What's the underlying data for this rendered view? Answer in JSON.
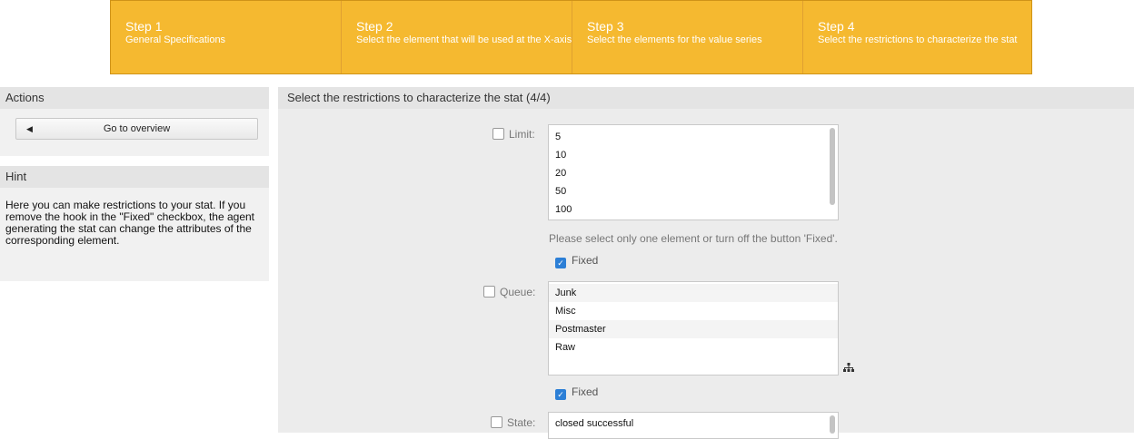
{
  "wizard": {
    "steps": [
      {
        "num": "Step 1",
        "desc": "General Specifications"
      },
      {
        "num": "Step 2",
        "desc": "Select the element that will be used at the X-axis"
      },
      {
        "num": "Step 3",
        "desc": "Select the elements for the value series"
      },
      {
        "num": "Step 4",
        "desc": "Select the restrictions to characterize the stat"
      }
    ]
  },
  "sidebar": {
    "actions_title": "Actions",
    "overview_label": "Go to overview",
    "hint_title": "Hint",
    "hint_text": "Here you can make restrictions to your stat. If you remove the hook in the \"Fixed\" checkbox, the agent generating the stat can change the attributes of the corresponding element."
  },
  "main": {
    "title": "Select the restrictions to characterize the stat (4/4)",
    "limit": {
      "label": "Limit:",
      "options": [
        "5",
        "10",
        "20",
        "50",
        "100"
      ],
      "note": "Please select only one element or turn off the button 'Fixed'.",
      "fixed_label": "Fixed"
    },
    "queue": {
      "label": "Queue:",
      "options": [
        "Junk",
        "Misc",
        "Postmaster",
        "Raw"
      ],
      "fixed_label": "Fixed"
    },
    "state": {
      "label": "State:",
      "options": [
        "closed successful"
      ]
    }
  },
  "colors": {
    "accent": "#f5b930",
    "checkbox": "#2c7fd6"
  },
  "icons": {
    "overview_back": "left-triangle-icon",
    "tree": "sitemap-icon"
  }
}
